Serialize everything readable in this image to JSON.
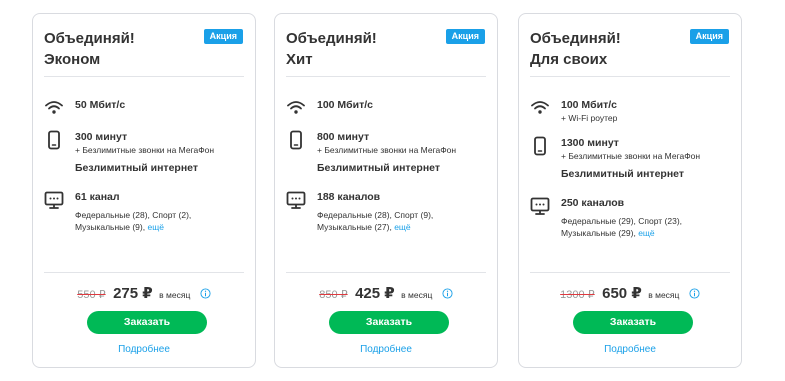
{
  "cards": [
    {
      "title_line1": "Объединяй!",
      "title_line2": "Эконом",
      "badge": "Акция",
      "speed": "50 Мбит/с",
      "speed_sub": "",
      "minutes": "300 минут",
      "minutes_sub": "+ Безлимитные звонки на МегаФон",
      "internet": "Безлимитный интернет",
      "tv": "61 канал",
      "tv_line1": "Федеральные (28), Спорт (2),",
      "tv_line2": "Музыкальные (9),",
      "tv_more": "ещё",
      "old_price": "550 ₽",
      "new_price": "275 ₽",
      "per_month": "в месяц",
      "order_label": "Заказать",
      "details_label": "Подробнее"
    },
    {
      "title_line1": "Объединяй!",
      "title_line2": "Хит",
      "badge": "Акция",
      "speed": "100 Мбит/с",
      "speed_sub": "",
      "minutes": "800 минут",
      "minutes_sub": "+ Безлимитные звонки на МегаФон",
      "internet": "Безлимитный интернет",
      "tv": "188 каналов",
      "tv_line1": "Федеральные (28), Спорт (9),",
      "tv_line2": "Музыкальные (27),",
      "tv_more": "ещё",
      "old_price": "850 ₽",
      "new_price": "425 ₽",
      "per_month": "в месяц",
      "order_label": "Заказать",
      "details_label": "Подробнее"
    },
    {
      "title_line1": "Объединяй!",
      "title_line2": "Для своих",
      "badge": "Акция",
      "speed": "100 Мбит/с",
      "speed_sub": "+ Wi-Fi роутер",
      "minutes": "1300 минут",
      "minutes_sub": "+ Безлимитные звонки на МегаФон",
      "internet": "Безлимитный интернет",
      "tv": "250 каналов",
      "tv_line1": "Федеральные (29), Спорт (23),",
      "tv_line2": "Музыкальные (29),",
      "tv_more": "ещё",
      "old_price": "1300 ₽",
      "new_price": "650 ₽",
      "per_month": "в месяц",
      "order_label": "Заказать",
      "details_label": "Подробнее"
    }
  ],
  "icons": {
    "speed": "wifi-icon",
    "minutes": "phone-icon",
    "tv": "tv-icon",
    "info": "info-icon"
  },
  "colors": {
    "accent": "#00b956",
    "link": "#1aa0e8",
    "badge": "#1aa0e8",
    "old_price_strike": "#e0393f"
  }
}
